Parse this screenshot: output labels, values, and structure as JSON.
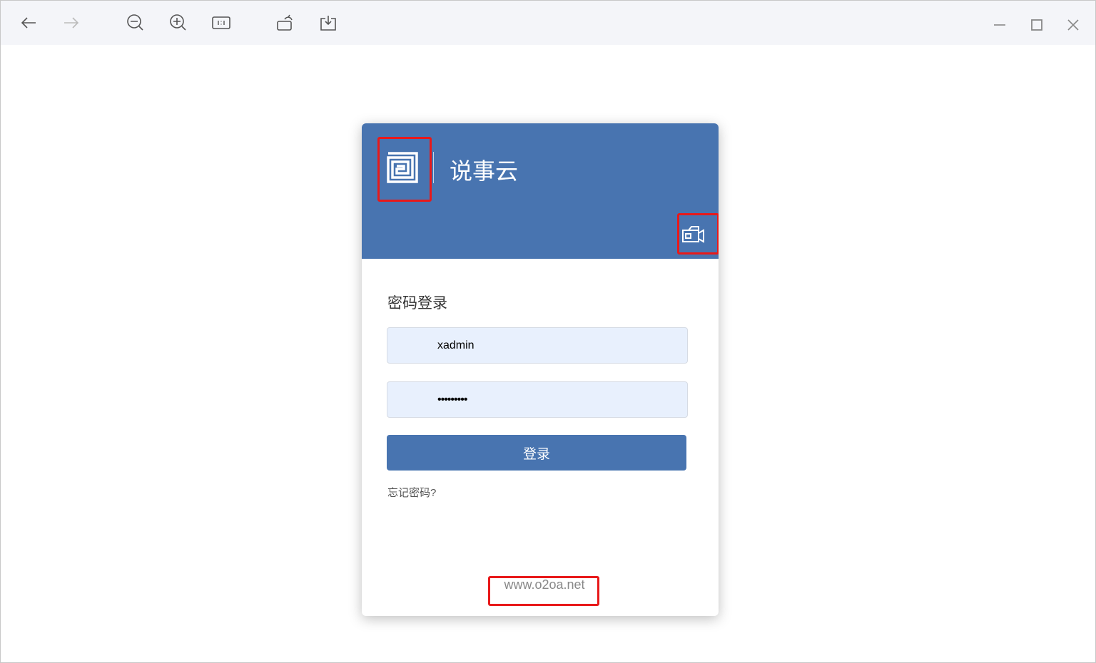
{
  "viewer": {
    "toolbar": [
      "back",
      "forward",
      "zoom-out",
      "zoom-in",
      "actual-size",
      "rotate",
      "download"
    ],
    "window_controls": [
      "minimize",
      "maximize",
      "close"
    ]
  },
  "login": {
    "app_title": "说事云",
    "section_title": "密码登录",
    "username_value": "xadmin",
    "password_value": "•••••••••",
    "login_button": "登录",
    "forgot_password": "忘记密码?",
    "website": "www.o2oa.net"
  },
  "colors": {
    "brand": "#4874b0",
    "input_bg": "#e8f0fd",
    "annotation": "#e8191a"
  }
}
